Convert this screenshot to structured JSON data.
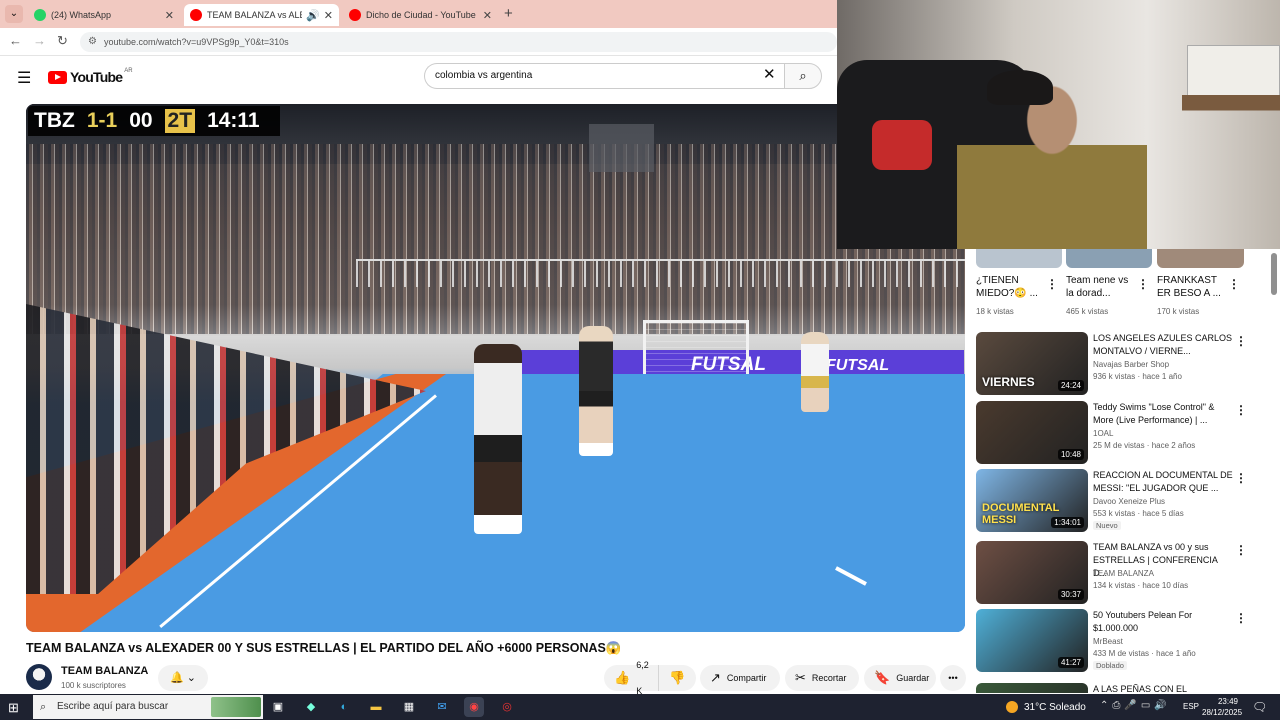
{
  "browser": {
    "tabs": [
      {
        "title": "(24) WhatsApp",
        "color": "#25d366"
      },
      {
        "title": "TEAM BALANZA vs ALEXAD",
        "color": "#ff0000"
      },
      {
        "title": "Dicho de Ciudad - YouTube",
        "color": "#ff0000"
      }
    ],
    "url": "youtube.com/watch?v=u9VPSg9p_Y0&t=310s"
  },
  "youtube": {
    "logo_text": "YouTube",
    "country": "AR",
    "search_value": "colombia vs argentina"
  },
  "video": {
    "scoreboard": {
      "team": "TBZ",
      "score": "1-1",
      "other": "00",
      "half": "2T",
      "clock": "14:11"
    },
    "ad_text_1": "FUTSAL",
    "ad_text_2": "FUTSAL",
    "title": "TEAM BALANZA vs ALEXADER 00 Y SUS ESTRELLAS | EL PARTIDO DEL AÑO +6000 PERSONAS😱",
    "channel_name": "TEAM BALANZA",
    "subscribers": "100 k suscriptores",
    "likes": "6,2 K",
    "share_label": "Compartir",
    "clip_label": "Recortar",
    "save_label": "Guardar"
  },
  "sidebar": {
    "shorts": [
      {
        "title": "¿TIENEN MIEDO?😳 ...",
        "views": "18 k vistas"
      },
      {
        "title": "Team nene vs la dorad...",
        "views": "465 k vistas"
      },
      {
        "title": "FRANKKAST ER BESO A ...",
        "views": "170 k vistas"
      }
    ],
    "videos": [
      {
        "title": "LOS ANGELES AZULES CARLOS MONTALVO / VIERNE...",
        "channel": "Navajas Barber Shop",
        "meta": "936 k vistas · hace 1 año",
        "duration": "24:24",
        "overlay": "VIERNES",
        "badge": "",
        "thumb_color": "#5a4a3e"
      },
      {
        "title": "Teddy Swims \"Lose Control\" & More (Live Performance) | ...",
        "channel": "1OAL",
        "meta": "25 M de vistas · hace 2 años",
        "duration": "10:48",
        "overlay": "",
        "badge": "",
        "thumb_color": "#4a3a2e"
      },
      {
        "title": "REACCION AL DOCUMENTAL DE MESSI: \"EL JUGADOR QUE ...",
        "channel": "Davoo Xeneize Plus",
        "meta": "553 k vistas · hace 5 días",
        "duration": "1:34:01",
        "overlay": "DOCUMENTAL MESSI",
        "badge": "Nuevo",
        "thumb_color": "#7fb6e6"
      },
      {
        "title": "TEAM BALANZA vs 00 y sus ESTRELLAS | CONFERENCIA D...",
        "channel": "TEAM BALANZA",
        "meta": "134 k vistas · hace 10 días",
        "duration": "30:37",
        "overlay": "",
        "badge": "",
        "thumb_color": "#6e4f44"
      },
      {
        "title": "50 Youtubers Pelean For $1.000.000",
        "channel": "MrBeast",
        "meta": "433 M de vistas · hace 1 año",
        "duration": "41:27",
        "overlay": "",
        "badge": "Doblado",
        "thumb_color": "#4fb0d8"
      },
      {
        "title": "A LAS PEÑAS CON EL REFERI?...",
        "channel": "",
        "meta": "",
        "duration": "",
        "overlay": "",
        "badge": "",
        "thumb_color": "#3a5a3a"
      }
    ]
  },
  "taskbar": {
    "search_placeholder": "Escribe aquí para buscar",
    "weather": "31°C  Soleado",
    "lang": "ESP",
    "time": "23:49",
    "date": "28/12/2025"
  }
}
